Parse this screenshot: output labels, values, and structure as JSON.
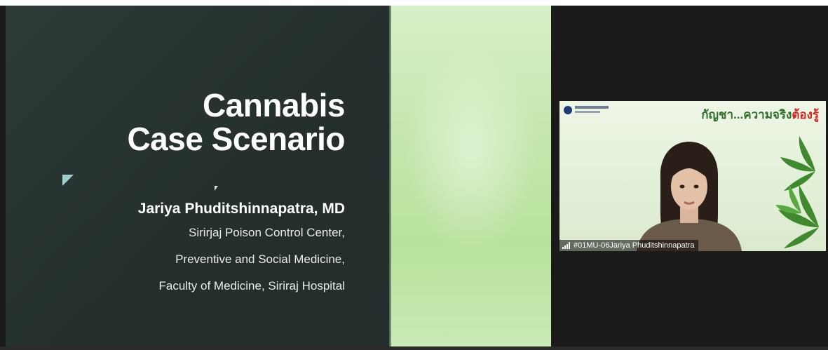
{
  "slide": {
    "title_line1": "Cannabis",
    "title_line2": "Case Scenario",
    "author": "Jariya Phuditshinnapatra, MD",
    "affiliation_1": "Sirirjaj Poison Control Center,",
    "affiliation_2": "Preventive and Social Medicine,",
    "affiliation_3": "Faculty of Medicine, Siriraj Hospital",
    "accent_color": "#9fd0d0"
  },
  "participant_video": {
    "background_slogan_part1": "กัญชา...ความจริง",
    "background_slogan_part2": "ต้องรู้",
    "display_name": "#01MU-06Jariya Phuditshinnapatra",
    "signal_icon": "signal-bars-icon"
  }
}
